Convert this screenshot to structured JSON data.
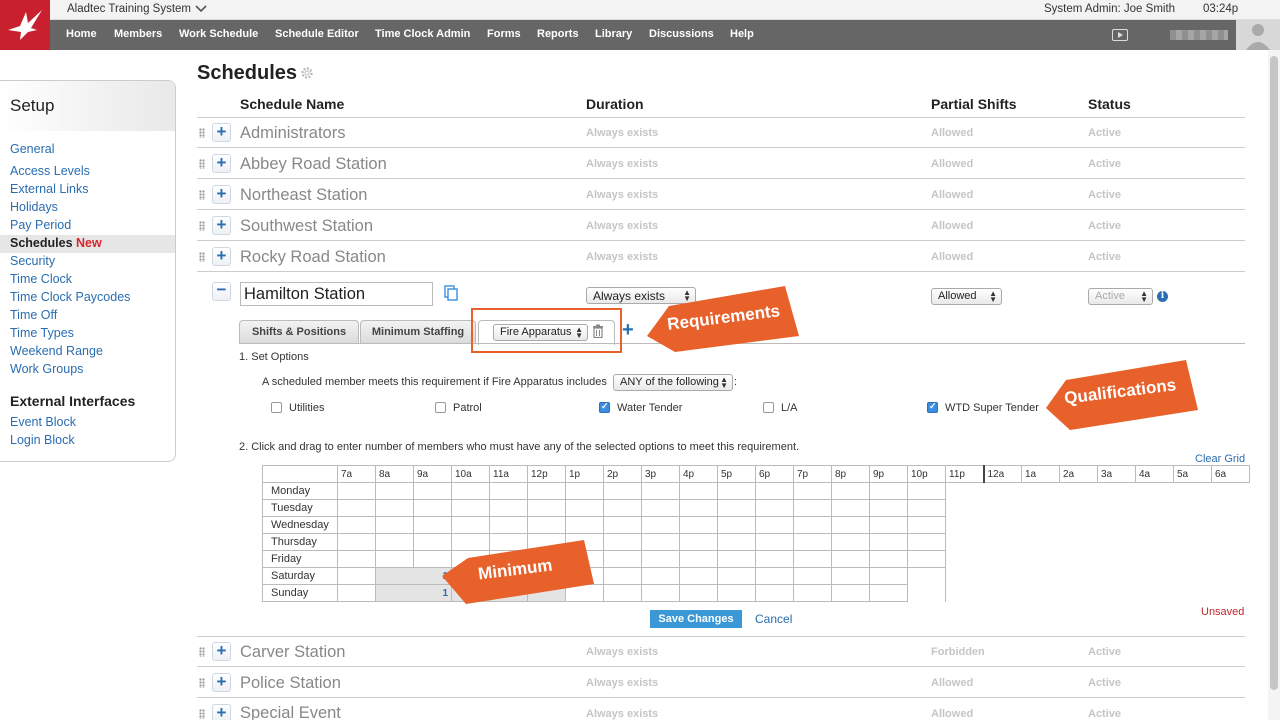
{
  "app": {
    "name": "Aladtec Training System",
    "admin_label": "System Admin:",
    "user": "Joe Smith",
    "time": "03:24p"
  },
  "nav": [
    "Home",
    "Members",
    "Work Schedule",
    "Schedule Editor",
    "Time Clock Admin",
    "Forms",
    "Reports",
    "Library",
    "Discussions",
    "Help"
  ],
  "sidebar": {
    "title": "Setup",
    "items": [
      "General",
      "Access Levels",
      "External Links",
      "Holidays",
      "Pay Period",
      "Schedules",
      "Security",
      "Time Clock",
      "Time Clock Paycodes",
      "Time Off",
      "Time Types",
      "Weekend Range",
      "Work Groups"
    ],
    "new_badge": "New",
    "section2": "External Interfaces",
    "items2": [
      "Event Block",
      "Login Block"
    ]
  },
  "page": {
    "title": "Schedules"
  },
  "columns": {
    "name": "Schedule Name",
    "duration": "Duration",
    "partial": "Partial Shifts",
    "status": "Status"
  },
  "rows_top": [
    {
      "name": "Administrators",
      "duration": "Always exists",
      "partial": "Allowed",
      "status": "Active"
    },
    {
      "name": "Abbey Road Station",
      "duration": "Always exists",
      "partial": "Allowed",
      "status": "Active"
    },
    {
      "name": "Northeast Station",
      "duration": "Always exists",
      "partial": "Allowed",
      "status": "Active"
    },
    {
      "name": "Southwest Station",
      "duration": "Always exists",
      "partial": "Allowed",
      "status": "Active"
    },
    {
      "name": "Rocky Road Station",
      "duration": "Always exists",
      "partial": "Allowed",
      "status": "Active"
    }
  ],
  "editor": {
    "name": "Hamilton Station",
    "duration": "Always exists",
    "partial": "Allowed",
    "status": "Active",
    "tabs": [
      "Shifts & Positions",
      "Minimum Staffing"
    ],
    "req_select": "Fire Apparatus",
    "step1": "1. Set Options",
    "rule_prefix": "A scheduled member meets this requirement if Fire Apparatus includes",
    "rule_select": "ANY of the following",
    "options": [
      {
        "label": "Utilities",
        "checked": false
      },
      {
        "label": "Patrol",
        "checked": false
      },
      {
        "label": "Water Tender",
        "checked": true
      },
      {
        "label": "L/A",
        "checked": false
      },
      {
        "label": "WTD Super Tender",
        "checked": true
      }
    ],
    "step2": "2. Click and drag to enter number of members who must have any of the selected options to meet this requirement.",
    "clear_grid": "Clear Grid",
    "hours": [
      "7a",
      "8a",
      "9a",
      "10a",
      "11a",
      "12p",
      "1p",
      "2p",
      "3p",
      "4p",
      "5p",
      "6p",
      "7p",
      "8p",
      "9p",
      "10p",
      "11p",
      "12a",
      "1a",
      "2a",
      "3a",
      "4a",
      "5a",
      "6a"
    ],
    "days": [
      "Monday",
      "Tuesday",
      "Wednesday",
      "Thursday",
      "Friday",
      "Saturday",
      "Sunday"
    ],
    "values": {
      "Saturday": "1",
      "Sunday": "1"
    },
    "save": "Save Changes",
    "cancel": "Cancel",
    "unsaved": "Unsaved"
  },
  "rows_bottom": [
    {
      "name": "Carver Station",
      "duration": "Always exists",
      "partial": "Forbidden",
      "status": "Active"
    },
    {
      "name": "Police Station",
      "duration": "Always exists",
      "partial": "Allowed",
      "status": "Active"
    },
    {
      "name": "Special Event",
      "duration": "Always exists",
      "partial": "Allowed",
      "status": "Active"
    }
  ],
  "callouts": {
    "requirements": "Requirements",
    "qualifications": "Qualifications",
    "minimum": "Minimum"
  },
  "colors": {
    "brand": "#c8202f",
    "nav": "#666666",
    "link": "#2a6db0",
    "callout": "#e8602a",
    "save": "#3a98d6"
  }
}
